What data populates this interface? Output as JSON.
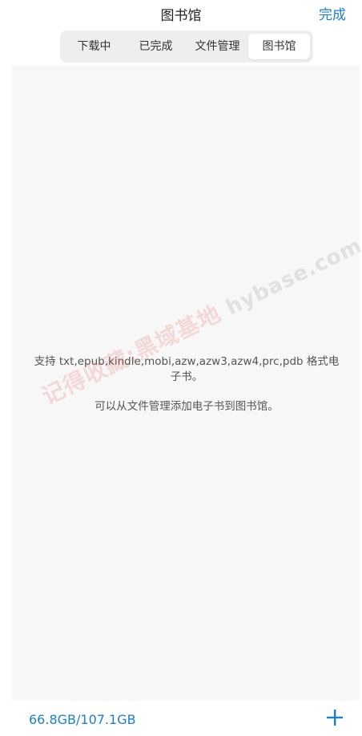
{
  "header": {
    "title": "图书馆",
    "done_label": "完成"
  },
  "tabs": [
    {
      "label": "下载中",
      "active": false
    },
    {
      "label": "已完成",
      "active": false
    },
    {
      "label": "文件管理",
      "active": false
    },
    {
      "label": "图书馆",
      "active": true
    }
  ],
  "empty_state": {
    "line1": "支持 txt,epub,kindle,mobi,azw,azw3,azw4,prc,pdb 格式电子书。",
    "line2": "可以从文件管理添加电子书到图书馆。"
  },
  "watermark": {
    "cn": "记得收藏:黑域基地",
    "en": "hybase.com"
  },
  "footer": {
    "storage": "66.8GB/107.1GB",
    "add_icon": "plus-icon"
  },
  "colors": {
    "accent": "#1a7fd1",
    "content_bg": "#f7f7f7",
    "tab_bar_bg": "#eeeeee"
  }
}
